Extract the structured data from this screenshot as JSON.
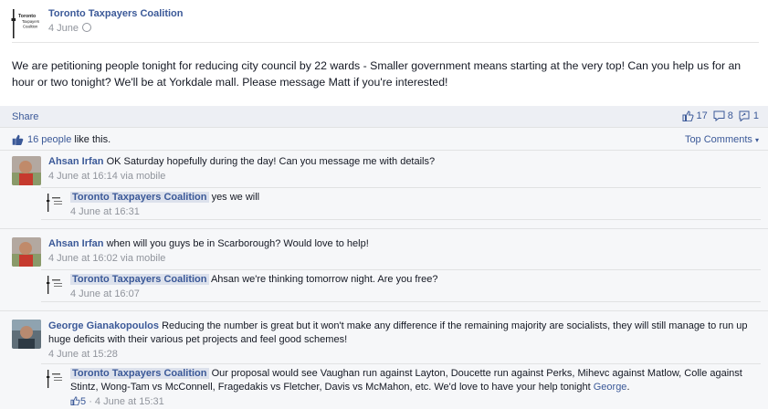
{
  "post": {
    "page_name": "Toronto Taxpayers Coalition",
    "logo_text": "Toronto Taxpayers Coalition",
    "time": "4 June",
    "text": "We are petitioning people tonight for reducing city council by 22 wards - Smaller government means starting at the very top! Can you help us for an hour or two tonight? We'll be at Yorkdale mall. Please message Matt if you're interested!"
  },
  "ufi": {
    "share_label": "Share",
    "likes_count": "17",
    "comments_count": "8",
    "shares_count": "1",
    "likes_people": "16 people",
    "likes_suffix": " like this.",
    "top_comments_label": "Top Comments"
  },
  "comments": [
    {
      "author": "Ahsan Irfan",
      "text": "OK Saturday hopefully during the day! Can you message me with details?",
      "meta": "4 June at 16:14 via mobile",
      "reply": {
        "author": "Toronto Taxpayers Coalition",
        "text": "yes we will",
        "meta": "4 June at 16:31"
      }
    },
    {
      "author": "Ahsan Irfan",
      "text": "when will you guys be in Scarborough? Would love to help!",
      "meta": "4 June at 16:02 via mobile",
      "reply": {
        "author": "Toronto Taxpayers Coalition",
        "text": "Ahsan we're thinking tomorrow night. Are you free?",
        "meta": "4 June at 16:07"
      }
    },
    {
      "author": "George Gianakopoulos",
      "text": "Reducing the number is great but it won't make any difference if the remaining majority are socialists, they will still manage to run up huge deficits with their various pet projects and feel good schemes!",
      "meta": "4 June at 15:28",
      "reply": {
        "author": "Toronto Taxpayers Coalition",
        "text": "Our proposal would see Vaughan run against Layton, Doucette run against Perks, Mihevc against Matlow, Colle against Stintz, Wong-Tam vs McConnell, Fragedakis vs Fletcher, Davis vs McMahon, etc. We'd love to have your help tonight",
        "mention": "George",
        "likes": "5",
        "meta": "4 June at 15:31"
      }
    }
  ],
  "colors": {
    "link": "#3b5998",
    "meta": "#90949c",
    "ufi_bg": "#f6f7f9",
    "highlight": "#dce1ec"
  },
  "icons": {
    "privacy": "globe-icon",
    "like": "thumbs-up-icon",
    "comment": "comment-bubble-icon",
    "share": "share-icon",
    "dropdown": "caret-down-icon"
  }
}
